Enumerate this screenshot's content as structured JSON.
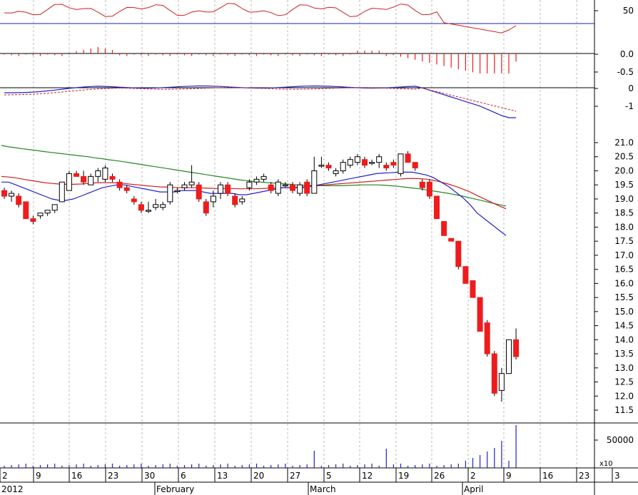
{
  "chart_data": {
    "type": "candlestick",
    "colors": {
      "up": "#ffffff",
      "down": "#ee1c1c",
      "outline": "#000000",
      "ma_fast": "#2222cc",
      "ma_mid": "#cc2222",
      "ma_slow": "#228822",
      "grid": "#bbbbbb",
      "volume": "#2222cc"
    },
    "x_axis": {
      "ticks": [
        "2",
        "9",
        "16",
        "23",
        "30",
        "6",
        "13",
        "20",
        "27",
        "5",
        "12",
        "19",
        "26",
        "2",
        "9",
        "16",
        "23",
        "3"
      ],
      "months": [
        "2012",
        "February",
        "March",
        "April"
      ]
    },
    "price_panel": {
      "ylim": [
        11.2,
        21.5
      ],
      "ticks": [
        "21.0",
        "20.5",
        "20.0",
        "19.5",
        "19.0",
        "18.5",
        "18.0",
        "17.5",
        "17.0",
        "16.5",
        "16.0",
        "15.5",
        "15.0",
        "14.5",
        "14.0",
        "13.5",
        "13.0",
        "12.5",
        "12.0",
        "11.5"
      ],
      "candles": [
        {
          "o": 19.3,
          "h": 19.4,
          "l": 19.0,
          "c": 19.1
        },
        {
          "o": 19.1,
          "h": 19.3,
          "l": 18.9,
          "c": 19.2
        },
        {
          "o": 19.1,
          "h": 19.2,
          "l": 18.7,
          "c": 18.8
        },
        {
          "o": 18.9,
          "h": 18.9,
          "l": 18.3,
          "c": 18.3
        },
        {
          "o": 18.3,
          "h": 18.4,
          "l": 18.1,
          "c": 18.2
        },
        {
          "o": 18.4,
          "h": 18.5,
          "l": 18.3,
          "c": 18.5
        },
        {
          "o": 18.5,
          "h": 18.6,
          "l": 18.4,
          "c": 18.6
        },
        {
          "o": 18.6,
          "h": 18.8,
          "l": 18.5,
          "c": 18.8
        },
        {
          "o": 18.9,
          "h": 19.6,
          "l": 18.9,
          "c": 19.6
        },
        {
          "o": 19.3,
          "h": 20.0,
          "l": 19.3,
          "c": 19.9
        },
        {
          "o": 19.9,
          "h": 20.0,
          "l": 19.8,
          "c": 19.8
        },
        {
          "o": 19.8,
          "h": 20.0,
          "l": 19.5,
          "c": 19.6
        },
        {
          "o": 19.5,
          "h": 19.9,
          "l": 19.5,
          "c": 19.8
        },
        {
          "o": 19.8,
          "h": 20.1,
          "l": 19.6,
          "c": 20.0
        },
        {
          "o": 19.7,
          "h": 20.2,
          "l": 19.6,
          "c": 20.1
        },
        {
          "o": 19.8,
          "h": 19.9,
          "l": 19.6,
          "c": 19.7
        },
        {
          "o": 19.6,
          "h": 19.7,
          "l": 19.3,
          "c": 19.4
        },
        {
          "o": 19.4,
          "h": 19.5,
          "l": 19.2,
          "c": 19.3
        },
        {
          "o": 19.0,
          "h": 19.1,
          "l": 18.8,
          "c": 18.9
        },
        {
          "o": 18.8,
          "h": 18.9,
          "l": 18.5,
          "c": 18.6
        },
        {
          "o": 18.6,
          "h": 18.9,
          "l": 18.5,
          "c": 18.6
        },
        {
          "o": 18.7,
          "h": 19.0,
          "l": 18.6,
          "c": 18.8
        },
        {
          "o": 18.7,
          "h": 18.9,
          "l": 18.6,
          "c": 18.8
        },
        {
          "o": 18.9,
          "h": 19.6,
          "l": 18.8,
          "c": 19.5
        },
        {
          "o": 19.3,
          "h": 19.4,
          "l": 19.2,
          "c": 19.3
        },
        {
          "o": 19.4,
          "h": 19.6,
          "l": 19.3,
          "c": 19.5
        },
        {
          "o": 19.5,
          "h": 20.2,
          "l": 19.4,
          "c": 19.6
        },
        {
          "o": 19.5,
          "h": 19.6,
          "l": 18.9,
          "c": 19.0
        },
        {
          "o": 18.9,
          "h": 19.0,
          "l": 18.4,
          "c": 18.5
        },
        {
          "o": 18.9,
          "h": 19.3,
          "l": 18.7,
          "c": 19.1
        },
        {
          "o": 19.2,
          "h": 19.6,
          "l": 19.0,
          "c": 19.5
        },
        {
          "o": 19.5,
          "h": 19.6,
          "l": 19.1,
          "c": 19.2
        },
        {
          "o": 19.1,
          "h": 19.2,
          "l": 18.7,
          "c": 18.8
        },
        {
          "o": 18.9,
          "h": 19.1,
          "l": 18.8,
          "c": 19.0
        },
        {
          "o": 19.4,
          "h": 19.7,
          "l": 19.3,
          "c": 19.6
        },
        {
          "o": 19.6,
          "h": 19.8,
          "l": 19.5,
          "c": 19.7
        },
        {
          "o": 19.7,
          "h": 19.9,
          "l": 19.6,
          "c": 19.8
        },
        {
          "o": 19.5,
          "h": 19.6,
          "l": 19.2,
          "c": 19.3
        },
        {
          "o": 19.2,
          "h": 19.7,
          "l": 19.1,
          "c": 19.6
        },
        {
          "o": 19.5,
          "h": 19.6,
          "l": 19.4,
          "c": 19.5
        },
        {
          "o": 19.5,
          "h": 19.6,
          "l": 19.2,
          "c": 19.3
        },
        {
          "o": 19.2,
          "h": 19.6,
          "l": 19.1,
          "c": 19.5
        },
        {
          "o": 19.6,
          "h": 19.7,
          "l": 19.1,
          "c": 19.2
        },
        {
          "o": 19.2,
          "h": 20.5,
          "l": 19.2,
          "c": 20.0
        },
        {
          "o": 20.2,
          "h": 20.5,
          "l": 20.1,
          "c": 20.2
        },
        {
          "o": 20.2,
          "h": 20.3,
          "l": 20.0,
          "c": 20.1
        },
        {
          "o": 19.9,
          "h": 20.1,
          "l": 19.8,
          "c": 20.0
        },
        {
          "o": 20.0,
          "h": 20.4,
          "l": 19.9,
          "c": 20.3
        },
        {
          "o": 20.2,
          "h": 20.5,
          "l": 20.1,
          "c": 20.4
        },
        {
          "o": 20.3,
          "h": 20.6,
          "l": 20.2,
          "c": 20.5
        },
        {
          "o": 20.4,
          "h": 20.5,
          "l": 20.1,
          "c": 20.2
        },
        {
          "o": 20.3,
          "h": 20.4,
          "l": 20.2,
          "c": 20.3
        },
        {
          "o": 20.3,
          "h": 20.6,
          "l": 20.1,
          "c": 20.5
        },
        {
          "o": 20.2,
          "h": 20.3,
          "l": 20.0,
          "c": 20.1
        },
        {
          "o": 20.3,
          "h": 20.4,
          "l": 20.1,
          "c": 20.2
        },
        {
          "o": 19.9,
          "h": 20.6,
          "l": 19.8,
          "c": 20.6
        },
        {
          "o": 20.6,
          "h": 20.7,
          "l": 20.3,
          "c": 20.3
        },
        {
          "o": 20.3,
          "h": 20.3,
          "l": 20.0,
          "c": 20.1
        },
        {
          "o": 19.6,
          "h": 19.7,
          "l": 19.3,
          "c": 19.4
        },
        {
          "o": 19.6,
          "h": 19.7,
          "l": 19.0,
          "c": 19.1
        },
        {
          "o": 19.1,
          "h": 19.1,
          "l": 18.3,
          "c": 18.3
        },
        {
          "o": 18.2,
          "h": 18.2,
          "l": 17.7,
          "c": 17.7
        },
        {
          "o": 17.6,
          "h": 17.6,
          "l": 17.5,
          "c": 17.5
        },
        {
          "o": 17.5,
          "h": 17.5,
          "l": 16.5,
          "c": 16.6
        },
        {
          "o": 16.6,
          "h": 16.6,
          "l": 16.0,
          "c": 16.0
        },
        {
          "o": 16.1,
          "h": 16.1,
          "l": 15.5,
          "c": 15.5
        },
        {
          "o": 15.5,
          "h": 15.5,
          "l": 14.3,
          "c": 14.3
        },
        {
          "o": 14.6,
          "h": 14.7,
          "l": 13.4,
          "c": 13.5
        },
        {
          "o": 13.5,
          "h": 13.6,
          "l": 12.0,
          "c": 12.1
        },
        {
          "o": 12.2,
          "h": 13.0,
          "l": 11.8,
          "c": 12.8
        },
        {
          "o": 12.8,
          "h": 14.0,
          "l": 12.8,
          "c": 14.0
        },
        {
          "o": 14.0,
          "h": 14.4,
          "l": 13.3,
          "c": 13.4
        }
      ],
      "ma_fast": [
        19.6,
        19.6,
        19.5,
        19.4,
        19.3,
        19.2,
        19.1,
        19.0,
        18.95,
        18.95,
        19.0,
        19.1,
        19.2,
        19.3,
        19.4,
        19.45,
        19.5,
        19.5,
        19.45,
        19.4,
        19.35,
        19.3,
        19.25,
        19.25,
        19.25,
        19.3,
        19.3,
        19.3,
        19.25,
        19.2,
        19.2,
        19.2,
        19.2,
        19.15,
        19.15,
        19.2,
        19.25,
        19.3,
        19.35,
        19.4,
        19.4,
        19.4,
        19.4,
        19.45,
        19.5,
        19.55,
        19.6,
        19.65,
        19.7,
        19.75,
        19.8,
        19.85,
        19.9,
        19.92,
        19.93,
        19.95,
        19.95,
        19.95,
        19.9,
        19.85,
        19.75,
        19.6,
        19.45,
        19.25,
        19.05,
        18.8,
        18.5,
        18.3,
        18.1,
        17.9,
        17.7
      ],
      "ma_mid": [
        19.8,
        19.78,
        19.75,
        19.7,
        19.66,
        19.62,
        19.58,
        19.55,
        19.53,
        19.52,
        19.52,
        19.53,
        19.55,
        19.57,
        19.58,
        19.58,
        19.57,
        19.55,
        19.52,
        19.5,
        19.47,
        19.45,
        19.43,
        19.42,
        19.41,
        19.4,
        19.4,
        19.4,
        19.39,
        19.38,
        19.37,
        19.37,
        19.37,
        19.36,
        19.36,
        19.36,
        19.37,
        19.38,
        19.39,
        19.4,
        19.41,
        19.42,
        19.44,
        19.46,
        19.48,
        19.5,
        19.52,
        19.54,
        19.56,
        19.58,
        19.6,
        19.62,
        19.64,
        19.66,
        19.68,
        19.7,
        19.72,
        19.73,
        19.72,
        19.7,
        19.66,
        19.6,
        19.53,
        19.45,
        19.35,
        19.25,
        19.12,
        19.0,
        18.88,
        18.76,
        18.65
      ],
      "ma_slow": [
        20.9,
        20.85,
        20.82,
        20.78,
        20.75,
        20.72,
        20.68,
        20.65,
        20.62,
        20.59,
        20.56,
        20.53,
        20.5,
        20.46,
        20.43,
        20.39,
        20.36,
        20.32,
        20.28,
        20.24,
        20.2,
        20.16,
        20.12,
        20.08,
        20.04,
        20.0,
        19.96,
        19.92,
        19.88,
        19.84,
        19.8,
        19.76,
        19.72,
        19.68,
        19.65,
        19.62,
        19.6,
        19.58,
        19.56,
        19.54,
        19.52,
        19.5,
        19.49,
        19.48,
        19.47,
        19.47,
        19.47,
        19.47,
        19.48,
        19.49,
        19.5,
        19.5,
        19.5,
        19.49,
        19.47,
        19.45,
        19.42,
        19.39,
        19.36,
        19.32,
        19.28,
        19.24,
        19.2,
        19.15,
        19.1,
        19.04,
        18.98,
        18.92,
        18.86,
        18.8,
        18.75
      ]
    },
    "rsi_panel": {
      "ticks": [
        "50"
      ]
    },
    "macd_hist_panel": {
      "ticks": [
        "0.0",
        "-0.5"
      ]
    },
    "macd_panel": {
      "ticks": [
        "0",
        "-1"
      ]
    },
    "volume_panel": {
      "ticks": [
        "50000"
      ],
      "scale_label": "x10"
    }
  }
}
